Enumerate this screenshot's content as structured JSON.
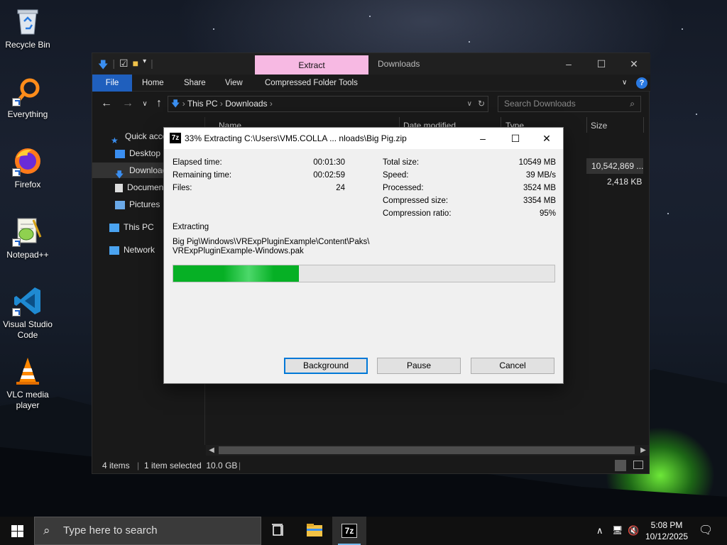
{
  "desktop": {
    "icons": [
      {
        "label": "Recycle Bin"
      },
      {
        "label": "Everything"
      },
      {
        "label": "Firefox"
      },
      {
        "label": "Notepad++"
      },
      {
        "label": "Visual Studio Code"
      },
      {
        "label": "VLC media player"
      }
    ]
  },
  "explorer": {
    "context_tab": "Extract",
    "window_title": "Downloads",
    "ribbon_tabs": [
      "File",
      "Home",
      "Share",
      "View",
      "Compressed Folder Tools"
    ],
    "address": {
      "segments": [
        "This PC",
        "Downloads"
      ]
    },
    "search_placeholder": "Search Downloads",
    "nav_items": [
      {
        "label": "Quick access"
      },
      {
        "label": "Desktop"
      },
      {
        "label": "Downloads"
      },
      {
        "label": "Documents"
      },
      {
        "label": "Pictures"
      },
      {
        "label": "This PC"
      },
      {
        "label": "Network"
      }
    ],
    "columns": [
      "Name",
      "Date modified",
      "Type",
      "Size"
    ],
    "sizes": [
      "10,542,869 ...",
      "2,418 KB"
    ],
    "status": {
      "items": "4 items",
      "selected": "1 item selected  10.0 GB"
    }
  },
  "dialog": {
    "title": "33% Extracting C:\\Users\\VM5.COLLA ... nloads\\Big Pig.zip",
    "percent": 33,
    "left_stats": [
      {
        "label": "Elapsed time:",
        "value": "00:01:30"
      },
      {
        "label": "Remaining time:",
        "value": "00:02:59"
      },
      {
        "label": "Files:",
        "value": "24"
      }
    ],
    "right_stats": [
      {
        "label": "Total size:",
        "value": "10549 MB"
      },
      {
        "label": "Speed:",
        "value": "39 MB/s"
      },
      {
        "label": "Processed:",
        "value": "3524 MB"
      },
      {
        "label": "Compressed size:",
        "value": "3354 MB"
      },
      {
        "label": "Compression ratio:",
        "value": "95%"
      }
    ],
    "action": "Extracting",
    "path_line1": "Big Pig\\Windows\\VRExpPluginExample\\Content\\Paks\\",
    "path_line2": "VRExpPluginExample-Windows.pak",
    "buttons": {
      "background": "Background",
      "pause": "Pause",
      "cancel": "Cancel"
    }
  },
  "taskbar": {
    "search_placeholder": "Type here to search",
    "time": "5:08 PM",
    "date": "10/12/2025"
  }
}
